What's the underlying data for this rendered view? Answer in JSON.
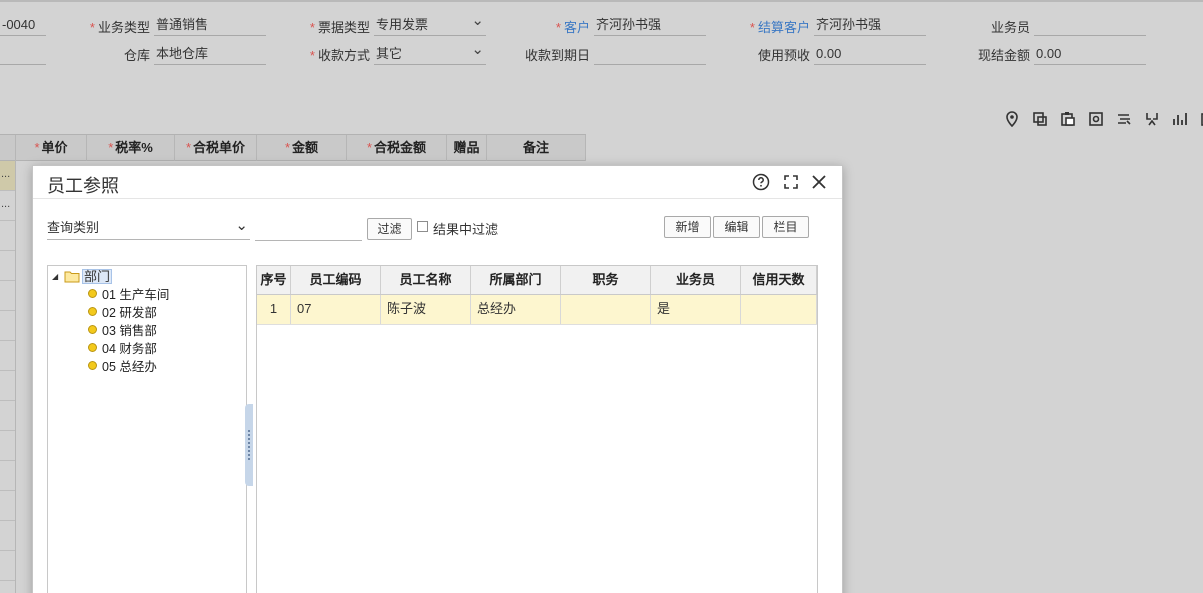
{
  "form": {
    "doc_no_suffix": "-0040",
    "business_type": {
      "label": "业务类型",
      "value": "普通销售"
    },
    "invoice_type": {
      "label": "票据类型",
      "value": "专用发票"
    },
    "customer": {
      "label": "客户",
      "value": "齐河孙书强"
    },
    "settle_customer": {
      "label": "结算客户",
      "value": "齐河孙书强"
    },
    "salesperson": {
      "label": "业务员",
      "value": ""
    },
    "warehouse": {
      "label": "仓库",
      "value": "本地仓库"
    },
    "payment_method": {
      "label": "收款方式",
      "value": "其它"
    },
    "due_date": {
      "label": "收款到期日",
      "value": ""
    },
    "use_prepay": {
      "label": "使用预收",
      "value": "0.00"
    },
    "cash_amount": {
      "label": "现结金额",
      "value": "0.00"
    }
  },
  "grid": {
    "columns": [
      "单价",
      "税率%",
      "合税单价",
      "金额",
      "合税金额",
      "赠品",
      "备注"
    ],
    "row_stubs": [
      "...",
      "..."
    ]
  },
  "modal": {
    "title": "员工参照",
    "query_category": "查询类别",
    "filter_button": "过滤",
    "filter_in_results": "结果中过滤",
    "new_button": "新增",
    "edit_button": "编辑",
    "columns_button": "栏目",
    "tree": {
      "root": "部门",
      "items": [
        "01 生产车间",
        "02 研发部",
        "03 销售部",
        "04 财务部",
        "05 总经办"
      ]
    },
    "table": {
      "headers": [
        "序号",
        "员工编码",
        "员工名称",
        "所属部门",
        "职务",
        "业务员",
        "信用天数"
      ],
      "rows": [
        {
          "no": "1",
          "code": "07",
          "name": "陈子波",
          "dept": "总经办",
          "title": "",
          "is_sales": "是",
          "credit_days": ""
        }
      ]
    }
  },
  "icons": {
    "toolbar": [
      "location-icon",
      "copy-icon",
      "paste-icon",
      "settings-box-icon",
      "format-icon",
      "scan-icon",
      "chart-icon",
      "report-icon"
    ],
    "modal_header": [
      "help-icon",
      "maximize-icon",
      "close-icon"
    ]
  },
  "colors": {
    "required": "#d9534f",
    "link_label": "#3a78c4",
    "selected_row": "#fdf6cf",
    "tree_dot": "#f3c91c"
  }
}
